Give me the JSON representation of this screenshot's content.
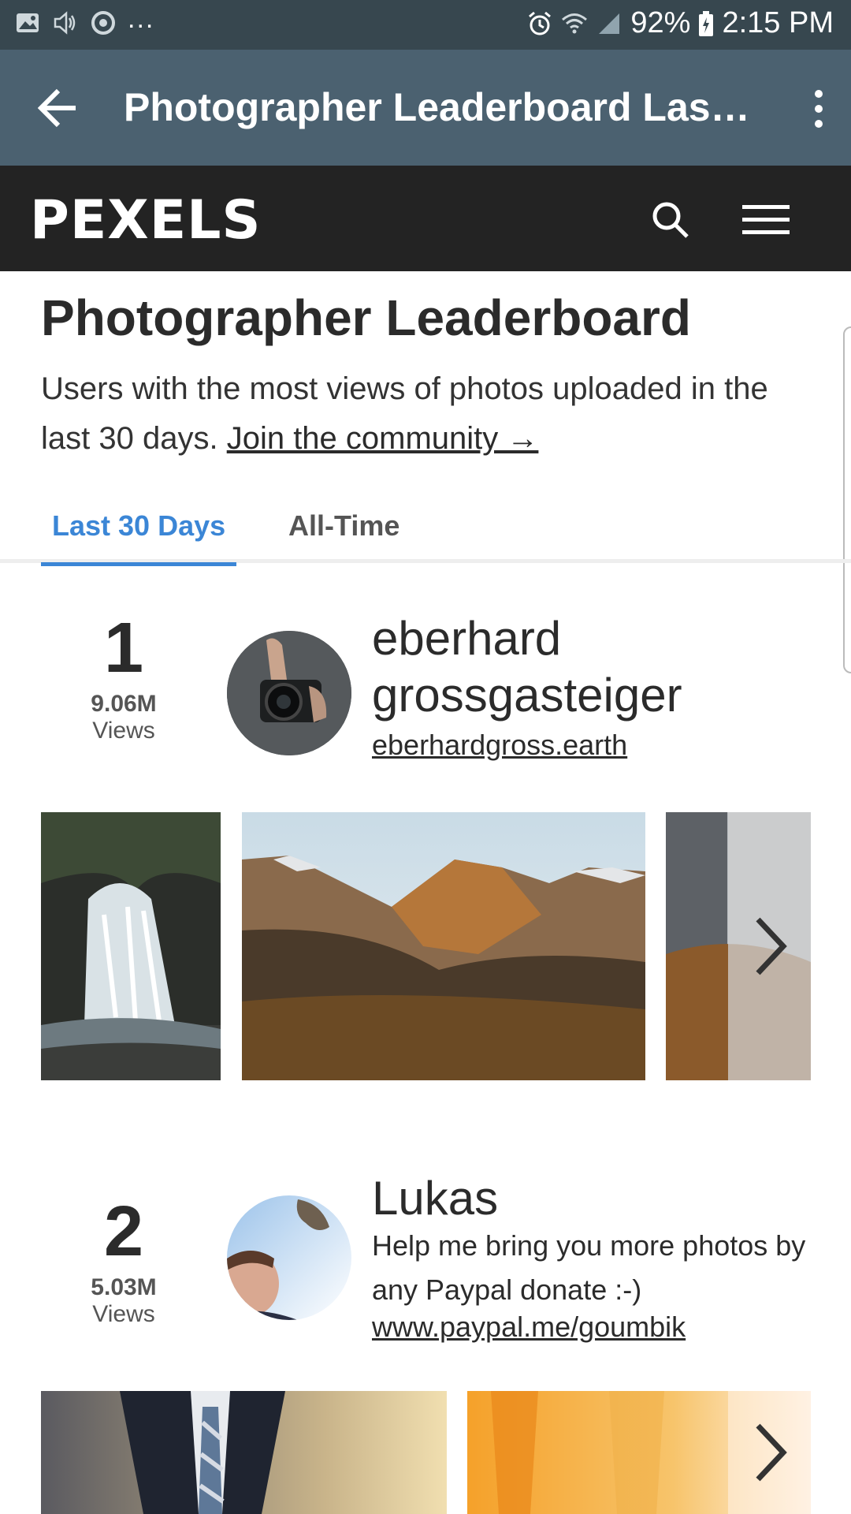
{
  "status_bar": {
    "dots": "...",
    "battery": "92%",
    "time": "2:15 PM"
  },
  "app_bar": {
    "title": "Photographer Leaderboard Last..."
  },
  "site_nav": {
    "logo": "PEXELS"
  },
  "page": {
    "title": "Photographer Leaderboard",
    "description": "Users with the most views of photos uploaded in the last 30 days.",
    "community_link": "Join the community →",
    "tabs": [
      {
        "label": "Last 30 Days",
        "active": true
      },
      {
        "label": "All-Time",
        "active": false
      }
    ]
  },
  "leaders": [
    {
      "rank": "1",
      "views": "9.06M",
      "views_label": "Views",
      "name": "eberhard grossgasteiger",
      "link": "eberhardgross.earth"
    },
    {
      "rank": "2",
      "views": "5.03M",
      "views_label": "Views",
      "name": "Lukas",
      "bio": "Help me bring you more photos by any Paypal donate :-)",
      "link": "www.paypal.me/goumbik"
    }
  ],
  "colors": {
    "accent": "#3b86d6",
    "app_bar": "#4b6170",
    "status_bar": "#37474f",
    "nav": "#232323"
  }
}
